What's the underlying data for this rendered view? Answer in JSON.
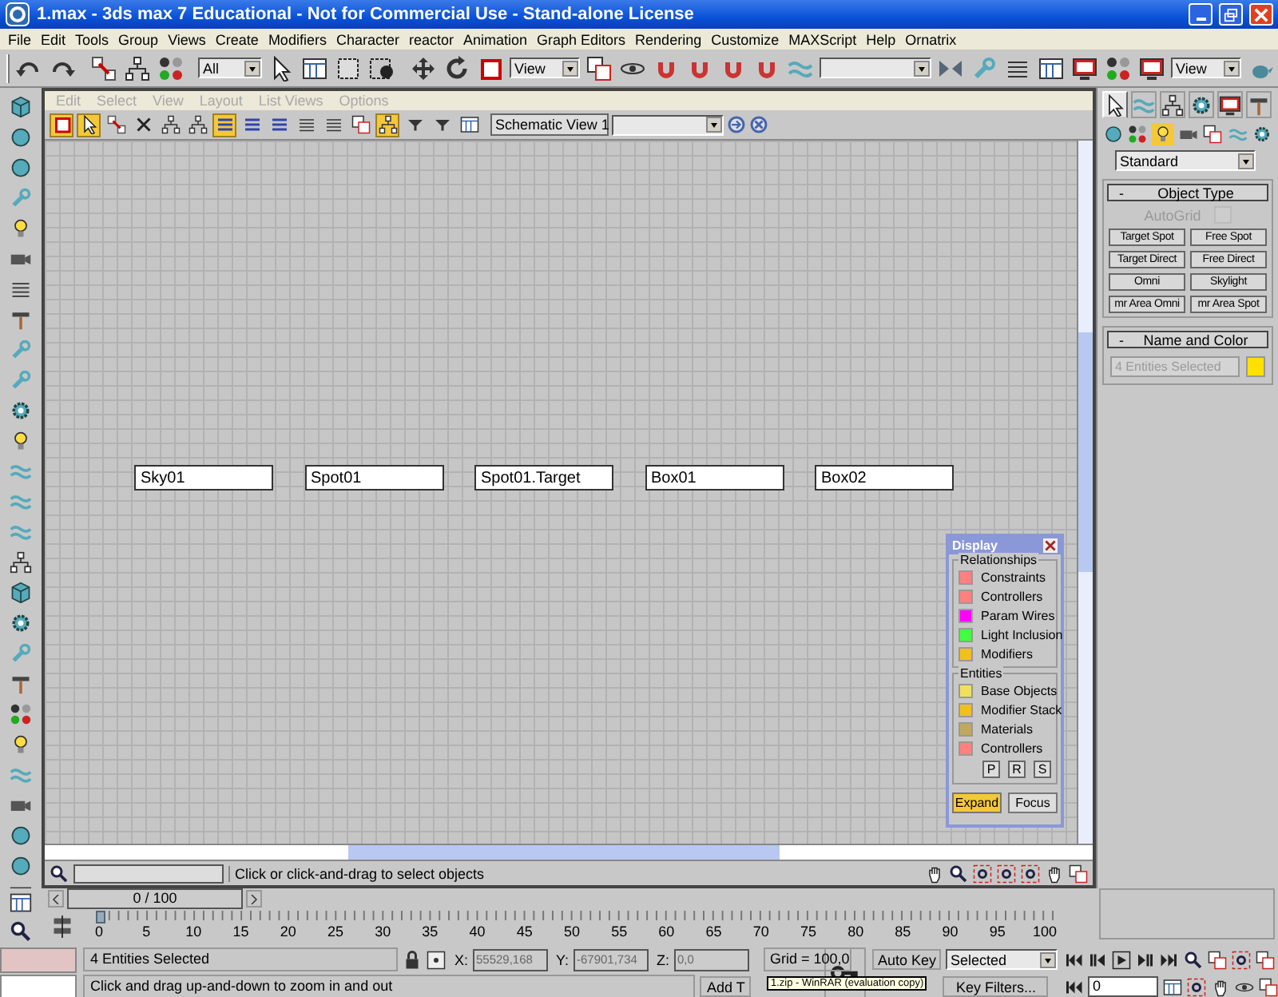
{
  "window": {
    "title": "1.max - 3ds max 7  Educational - Not for Commercial Use - Stand-alone License"
  },
  "menu": [
    "File",
    "Edit",
    "Tools",
    "Group",
    "Views",
    "Create",
    "Modifiers",
    "Character",
    "reactor",
    "Animation",
    "Graph Editors",
    "Rendering",
    "Customize",
    "MAXScript",
    "Help",
    "Ornatrix"
  ],
  "main_toolbar": {
    "selection_filter": "All",
    "reference_coord": "View",
    "render_view": "View"
  },
  "schematic": {
    "menu": [
      {
        "label": "Edit",
        "disabled": true
      },
      {
        "label": "Select",
        "disabled": true
      },
      {
        "label": "View",
        "disabled": true
      },
      {
        "label": "Layout",
        "disabled": true
      },
      {
        "label": "List Views",
        "disabled": true
      },
      {
        "label": "Options",
        "disabled": true
      }
    ],
    "toolbar_buttons": [
      {
        "on": true
      },
      {
        "on": true
      },
      {
        "on": false
      },
      {
        "on": false
      },
      {
        "on": false
      },
      {
        "on": false
      },
      {
        "on": true
      },
      {
        "on": false
      },
      {
        "on": false
      },
      {
        "on": false
      },
      {
        "on": false
      },
      {
        "on": false
      },
      {
        "on": true
      },
      {
        "on": false
      },
      {
        "on": false
      },
      {
        "on": false
      }
    ],
    "view_name": "Schematic View 1",
    "nodes": [
      "Sky01",
      "Spot01",
      "Spot01.Target",
      "Box01",
      "Box02"
    ],
    "prompt": "Click or click-and-drag to select objects",
    "display": {
      "title": "Display",
      "groups": [
        {
          "title": "Relationships",
          "items": [
            {
              "label": "Constraints",
              "color": "#ff8080"
            },
            {
              "label": "Controllers",
              "color": "#ff8080"
            },
            {
              "label": "Param Wires",
              "color": "#ff00ff"
            },
            {
              "label": "Light Inclusion",
              "color": "#40ff40"
            },
            {
              "label": "Modifiers",
              "color": "#f0c020"
            }
          ]
        },
        {
          "title": "Entities",
          "items": [
            {
              "label": "Base Objects",
              "color": "#f0e060"
            },
            {
              "label": "Modifier Stack",
              "color": "#f0c020"
            },
            {
              "label": "Materials",
              "color": "#c0a860"
            },
            {
              "label": "Controllers",
              "color": "#ff8080"
            }
          ],
          "buttons": [
            "P",
            "R",
            "S"
          ]
        }
      ],
      "actions": [
        {
          "label": "Expand",
          "selected": true
        },
        {
          "label": "Focus",
          "selected": false
        }
      ]
    }
  },
  "command_panel": {
    "tabs": [
      {
        "selected": true
      },
      {
        "selected": false
      },
      {
        "selected": false
      },
      {
        "selected": false
      },
      {
        "selected": false
      },
      {
        "selected": false
      }
    ],
    "categories": [
      {
        "selected": false
      },
      {
        "selected": false
      },
      {
        "selected": true
      },
      {
        "selected": false
      },
      {
        "selected": false
      },
      {
        "selected": false
      },
      {
        "selected": false
      }
    ],
    "type": "Standard",
    "object_type": {
      "toggle": "-",
      "title": "Object Type",
      "autogrid": {
        "label": "AutoGrid",
        "checked": false,
        "disabled": true
      },
      "buttons": [
        "Target Spot",
        "Free Spot",
        "Target Direct",
        "Free Direct",
        "Omni",
        "Skylight",
        "mr Area Omni",
        "mr Area Spot"
      ]
    },
    "name_and_color": {
      "toggle": "-",
      "title": "Name and Color",
      "name": "4 Entities Selected",
      "color": "#ffe000"
    }
  },
  "timeline": {
    "slider": "0 / 100",
    "ticks": [
      "0",
      "5",
      "10",
      "15",
      "20",
      "25",
      "30",
      "35",
      "40",
      "45",
      "50",
      "55",
      "60",
      "65",
      "70",
      "75",
      "80",
      "85",
      "90",
      "95",
      "100"
    ]
  },
  "status_bar": {
    "selection": "4 Entities Selected",
    "prompt": "Click and drag up-and-down to zoom in and out",
    "coordinates": [
      {
        "label": "X:",
        "value": "55529,168"
      },
      {
        "label": "Y:",
        "value": "-67901,734"
      },
      {
        "label": "Z:",
        "value": "0,0"
      }
    ],
    "grid": "Grid = 100,0",
    "add_time_tag": "Add T",
    "tooltip": "1.zip - WinRAR (evaluation copy)",
    "auto_key": "Auto Key",
    "key_mode": "Selected",
    "key_filters": "Key Filters...",
    "frame": "0"
  }
}
